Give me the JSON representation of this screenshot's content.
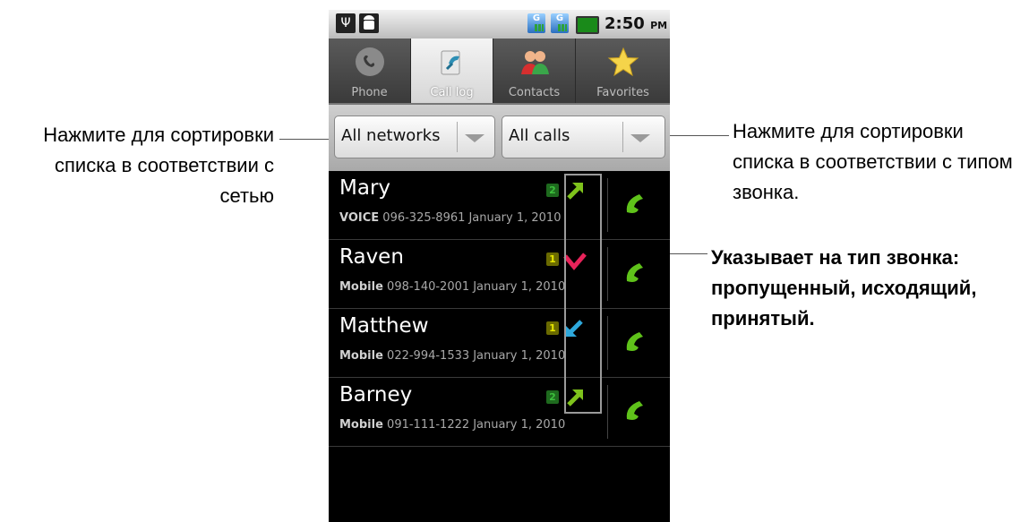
{
  "status_bar": {
    "time": "2:50",
    "ampm": "PM",
    "sim1_label": "G",
    "sim2_label": "G"
  },
  "tabs": [
    {
      "label": "Phone",
      "icon": "phone-icon"
    },
    {
      "label": "Call log",
      "icon": "call-log-icon"
    },
    {
      "label": "Contacts",
      "icon": "contacts-icon"
    },
    {
      "label": "Favorites",
      "icon": "star-icon"
    }
  ],
  "filters": {
    "network": "All networks",
    "calls": "All calls"
  },
  "calls": [
    {
      "name": "Mary",
      "type_label": "VOICE",
      "number": "096-325-8961",
      "date": "January 1, 2010",
      "network": "2",
      "call_type": "outgoing"
    },
    {
      "name": "Raven",
      "type_label": "Mobile",
      "number": "098-140-2001",
      "date": "January 1, 2010",
      "network": "1",
      "call_type": "missed"
    },
    {
      "name": "Matthew",
      "type_label": "Mobile",
      "number": "022-994-1533",
      "date": "January 1, 2010",
      "network": "1",
      "call_type": "received"
    },
    {
      "name": "Barney",
      "type_label": "Mobile",
      "number": "091-111-1222",
      "date": "January 1, 2010",
      "network": "2",
      "call_type": "outgoing"
    }
  ],
  "annotations": {
    "network_filter": "Нажмите для сортировки списка в соответствии с сетью",
    "calls_filter": "Нажмите для сортировки списка в соответствии с типом звонка.",
    "call_type": "Указывает на тип звонка: пропущенный, исходящий, принятый."
  },
  "colors": {
    "outgoing": "#7fc31c",
    "missed": "#e8235a",
    "received": "#2ea8dc",
    "network1": "#e6e600",
    "network2": "#3cbf3c",
    "call_button": "#5fc21a"
  }
}
